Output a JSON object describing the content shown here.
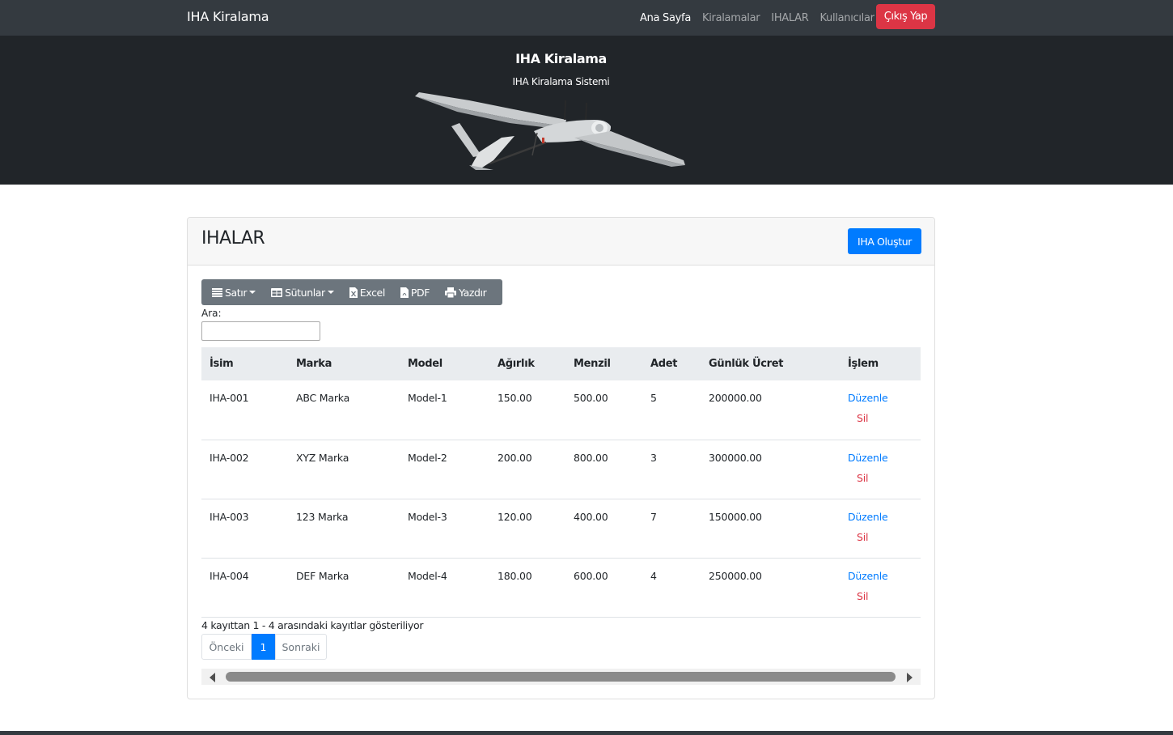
{
  "navbar": {
    "brand": "IHA Kiralama",
    "links": [
      {
        "label": "Ana Sayfa"
      },
      {
        "label": "Kiralamalar"
      },
      {
        "label": "IHALAR"
      },
      {
        "label": "Kullanıcılar"
      }
    ],
    "logout_label": "Çıkış Yap"
  },
  "hero": {
    "title": "IHA Kiralama",
    "subtitle": "IHA Kiralama Sistemi"
  },
  "card": {
    "title": "IHALAR",
    "create_label": "IHA Oluştur"
  },
  "toolbar": {
    "rows_label": "Satır",
    "columns_label": "Sütunlar",
    "excel_label": "Excel",
    "pdf_label": "PDF",
    "print_label": "Yazdır"
  },
  "search": {
    "label": "Ara:",
    "value": ""
  },
  "table": {
    "headers": [
      "İsim",
      "Marka",
      "Model",
      "Ağırlık",
      "Menzil",
      "Adet",
      "Günlük Ücret",
      "İşlem"
    ],
    "rows": [
      {
        "name": "IHA-001",
        "brand": "ABC Marka",
        "model": "Model-1",
        "weight": "150.00",
        "range": "500.00",
        "count": "5",
        "daily": "200000.00",
        "edit": "Düzenle",
        "delete": "Sil"
      },
      {
        "name": "IHA-002",
        "brand": "XYZ Marka",
        "model": "Model-2",
        "weight": "200.00",
        "range": "800.00",
        "count": "3",
        "daily": "300000.00",
        "edit": "Düzenle",
        "delete": "Sil"
      },
      {
        "name": "IHA-003",
        "brand": "123 Marka",
        "model": "Model-3",
        "weight": "120.00",
        "range": "400.00",
        "count": "7",
        "daily": "150000.00",
        "edit": "Düzenle",
        "delete": "Sil"
      },
      {
        "name": "IHA-004",
        "brand": "DEF Marka",
        "model": "Model-4",
        "weight": "180.00",
        "range": "600.00",
        "count": "4",
        "daily": "250000.00",
        "edit": "Düzenle",
        "delete": "Sil"
      }
    ]
  },
  "pagination": {
    "info": "4 kayıttan 1 - 4 arasındaki kayıtlar gösteriliyor",
    "prev_label": "Önceki",
    "current_page": "1",
    "next_label": "Sonraki"
  },
  "colors": {
    "navbar_bg": "#343a40",
    "hero_bg": "#212529",
    "primary": "#007bff",
    "danger": "#dc3545",
    "secondary": "#6c757d"
  },
  "icons": [
    "bars-icon",
    "table-icon",
    "excel-file-icon",
    "pdf-file-icon",
    "print-icon"
  ]
}
